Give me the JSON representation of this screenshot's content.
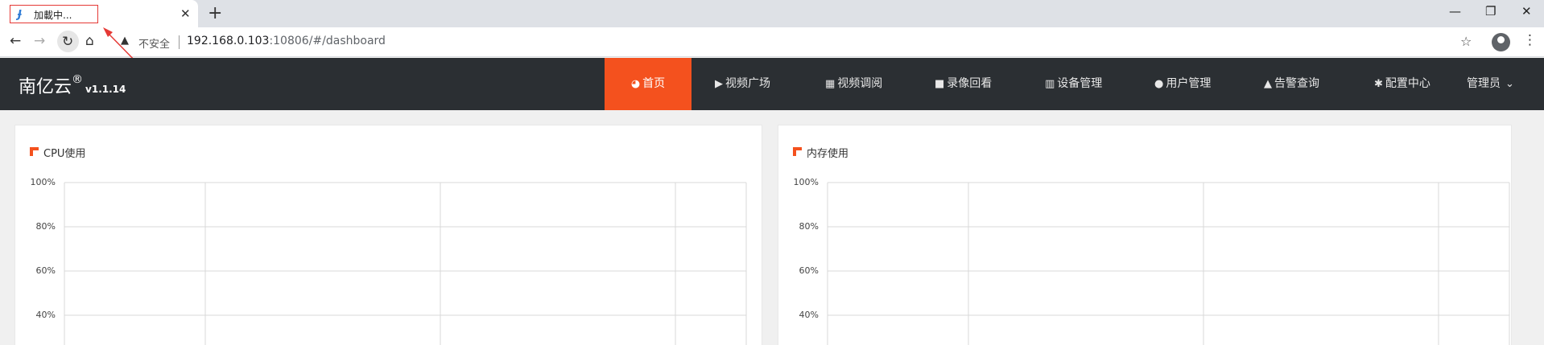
{
  "browser": {
    "tab_title": "加載中...",
    "tab_favicon": "Ɉ",
    "close_glyph": "✕",
    "newtab_glyph": "+",
    "security_label": "不安全",
    "url_host": "192.168.0.103",
    "url_rest": ":10806/#/dashboard"
  },
  "app": {
    "brand": "南亿云",
    "brand_mark": "®",
    "version": "v1.1.14",
    "accent_color": "#f4511e",
    "header_color": "#2b2f33"
  },
  "nav": {
    "items": [
      {
        "label": "首页",
        "icon": "dashboard-icon"
      },
      {
        "label": "视频广场",
        "icon": "play-circle-icon"
      },
      {
        "label": "视频调阅",
        "icon": "table-icon"
      },
      {
        "label": "录像回看",
        "icon": "video-camera-icon"
      },
      {
        "label": "设备管理",
        "icon": "server-icon"
      },
      {
        "label": "用户管理",
        "icon": "user-icon"
      },
      {
        "label": "告警查询",
        "icon": "alarm-icon"
      },
      {
        "label": "配置中心",
        "icon": "gear-icon"
      },
      {
        "label": "管理员",
        "icon": "chevron-down-icon"
      }
    ]
  },
  "panels": {
    "cpu_title": "CPU使用",
    "memory_title": "内存使用"
  },
  "chart_data": [
    {
      "type": "line",
      "title": "CPU使用",
      "y_ticks": [
        "100%",
        "80%",
        "60%",
        "40%"
      ],
      "ylim": [
        0,
        100
      ],
      "series": [],
      "grid": true
    },
    {
      "type": "line",
      "title": "内存使用",
      "y_ticks": [
        "100%",
        "80%",
        "60%",
        "40%"
      ],
      "ylim": [
        0,
        100
      ],
      "series": [],
      "grid": true
    }
  ]
}
